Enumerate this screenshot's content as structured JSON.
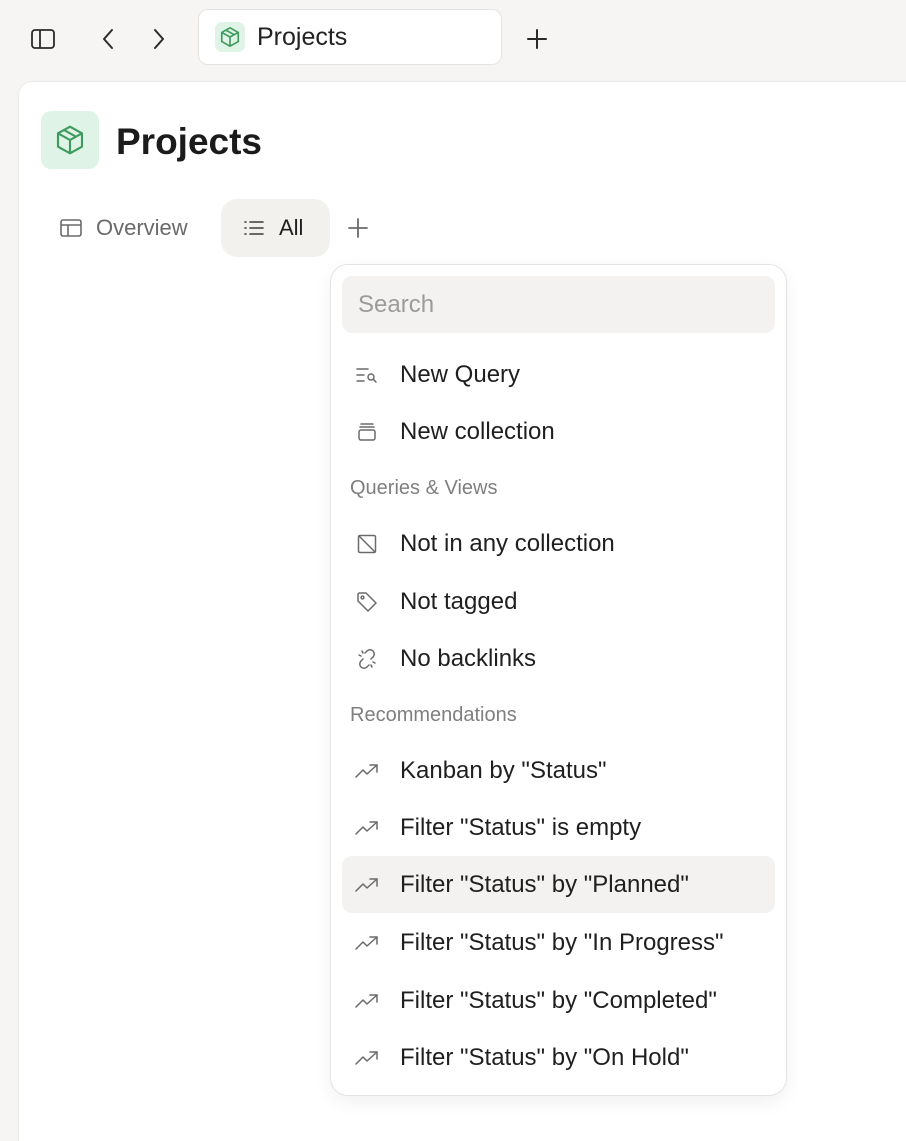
{
  "tab": {
    "title": "Projects"
  },
  "page": {
    "title": "Projects"
  },
  "views": [
    {
      "label": "Overview"
    },
    {
      "label": "All"
    }
  ],
  "menu": {
    "search_placeholder": "Search",
    "actions": [
      {
        "label": "New Query",
        "icon": "query-icon"
      },
      {
        "label": "New collection",
        "icon": "collection-icon"
      }
    ],
    "queries_header": "Queries & Views",
    "queries": [
      {
        "label": "Not in any collection",
        "icon": "no-collection-icon"
      },
      {
        "label": "Not tagged",
        "icon": "tag-icon"
      },
      {
        "label": "No backlinks",
        "icon": "broken-link-icon"
      }
    ],
    "recommendations_header": "Recommendations",
    "recommendations": [
      {
        "label": "Kanban by \"Status\"",
        "icon": "trending-icon"
      },
      {
        "label": "Filter \"Status\" is empty",
        "icon": "trending-icon"
      },
      {
        "label": "Filter \"Status\" by \"Planned\"",
        "icon": "trending-icon",
        "highlighted": true
      },
      {
        "label": "Filter \"Status\" by \"In Progress\"",
        "icon": "trending-icon"
      },
      {
        "label": "Filter \"Status\" by \"Completed\"",
        "icon": "trending-icon"
      },
      {
        "label": "Filter \"Status\" by \"On Hold\"",
        "icon": "trending-icon"
      }
    ]
  },
  "colors": {
    "accent_green": "#3f9a5e",
    "icon_bg_green": "#dff4e6",
    "highlight": "#f3f2f0"
  }
}
